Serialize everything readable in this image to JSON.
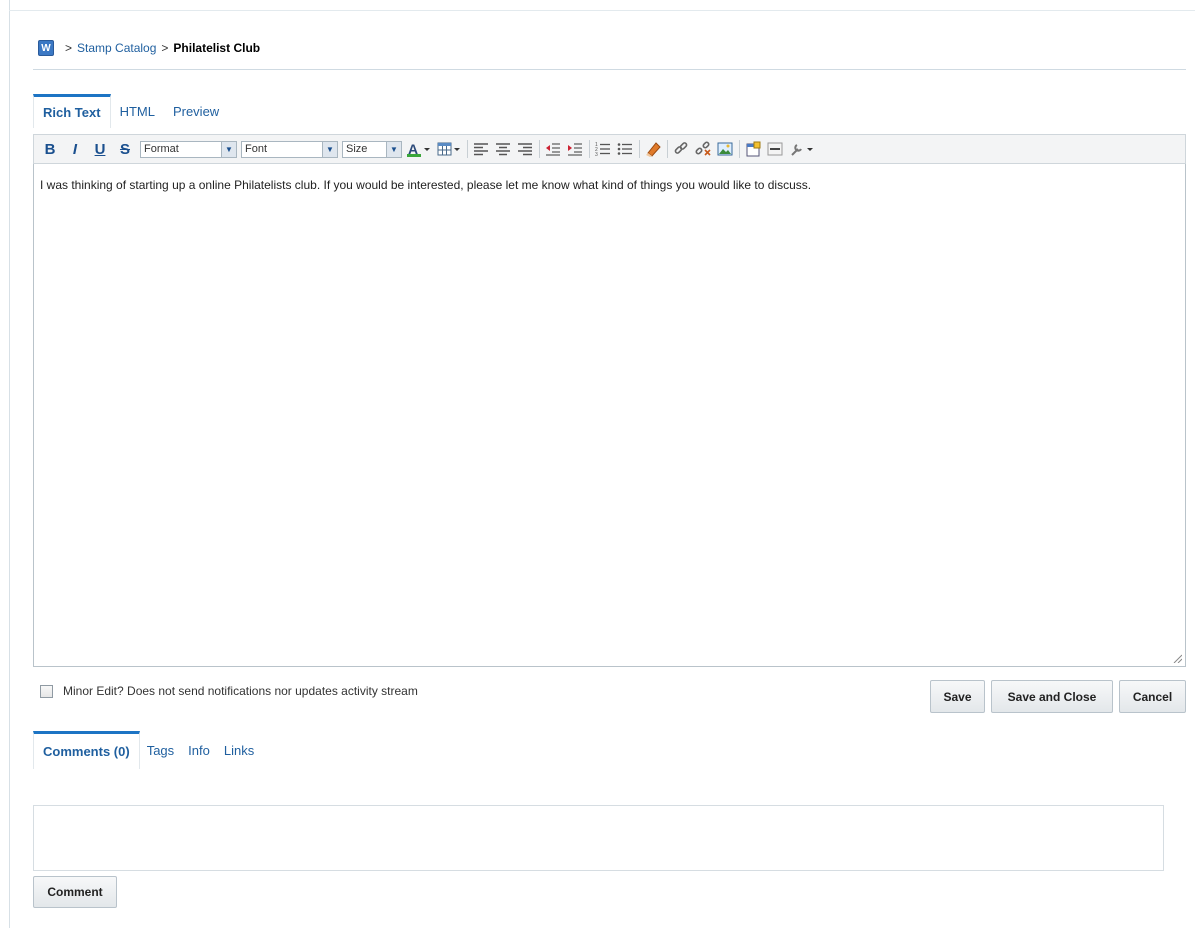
{
  "breadcrumb": {
    "icon_letter": "W",
    "separator": ">",
    "parent": "Stamp Catalog",
    "current": "Philatelist Club"
  },
  "editor_tabs": [
    {
      "label": "Rich Text",
      "active": true
    },
    {
      "label": "HTML",
      "active": false
    },
    {
      "label": "Preview",
      "active": false
    }
  ],
  "toolbar": {
    "bold": "B",
    "italic": "I",
    "underline": "U",
    "strike": "S",
    "format_select": "Format",
    "font_select": "Font",
    "size_select": "Size",
    "icons": [
      "text-color-icon",
      "table-icon",
      "align-left-icon",
      "align-center-icon",
      "align-right-icon",
      "outdent-icon",
      "indent-icon",
      "numbered-list-icon",
      "bulleted-list-icon",
      "eraser-icon",
      "link-icon",
      "unlink-icon",
      "image-icon",
      "template-icon",
      "horizontal-rule-icon",
      "tools-icon"
    ]
  },
  "editor": {
    "content": "I was thinking of starting up a online Philatelists  club. If you would be interested, please let me know what kind of things you would like to discuss."
  },
  "minor_edit": {
    "label": "Minor Edit? Does not send notifications nor updates activity stream",
    "checked": false
  },
  "actions": {
    "save": "Save",
    "save_close": "Save and Close",
    "cancel": "Cancel"
  },
  "bottom_tabs": [
    {
      "label": "Comments (0)",
      "active": true
    },
    {
      "label": "Tags",
      "active": false
    },
    {
      "label": "Info",
      "active": false
    },
    {
      "label": "Links",
      "active": false
    }
  ],
  "comment": {
    "value": "",
    "button": "Comment"
  },
  "colors": {
    "accent": "#1c74c4",
    "link": "#1f5f9f"
  }
}
